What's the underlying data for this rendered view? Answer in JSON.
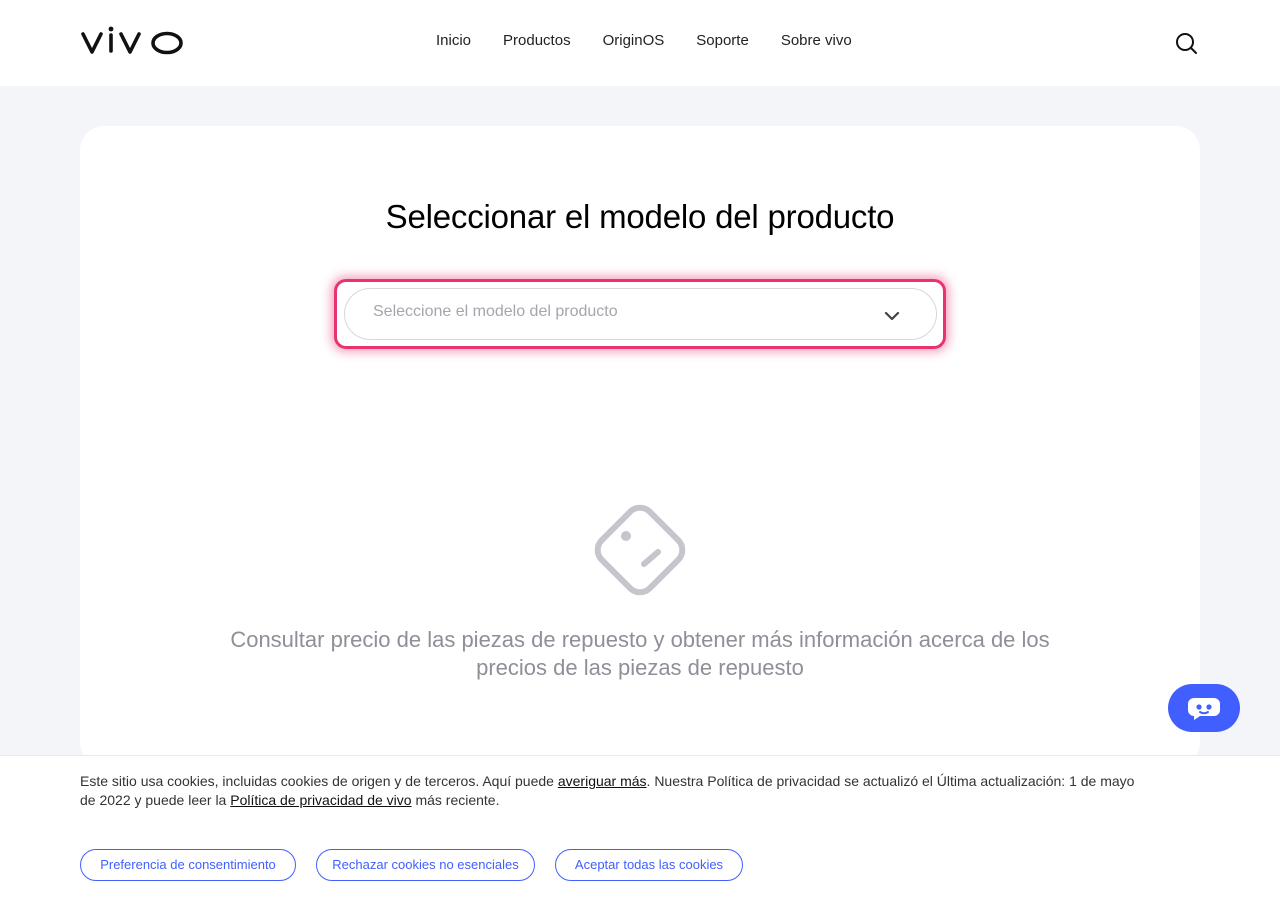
{
  "header": {
    "logo": "vivo",
    "nav": [
      "Inicio",
      "Productos",
      "OriginOS",
      "Soporte",
      "Sobre vivo"
    ],
    "search_icon": "search-icon"
  },
  "main": {
    "title": "Seleccionar el modelo del producto",
    "select": {
      "placeholder": "Seleccione el modelo del producto",
      "icon": "chevron-down-icon"
    },
    "empty_state": {
      "icon": "tag-face-icon",
      "text": "Consultar precio de las piezas de repuesto y obtener más información acerca de los precios de las piezas de repuesto"
    }
  },
  "chat_button": {
    "icon": "chatbot-icon"
  },
  "cookie_banner": {
    "text_part1": "Este sitio usa cookies, incluidas cookies de origen y de terceros. Aquí puede ",
    "link_learn_more": "averiguar más",
    "text_part2": ". Nuestra Política de privacidad se actualizó el Última actualización: 1 de mayo de 2022 y puede leer la ",
    "link_privacy": "Política de privacidad de vivo",
    "text_part3": " más reciente.",
    "buttons": {
      "preference": "Preferencia de consentimiento",
      "reject": "Rechazar cookies no esenciales",
      "accept": "Aceptar todas las cookies"
    }
  },
  "colors": {
    "accent": "#415fff",
    "highlight": "#e8336d",
    "page_bg": "#f4f5f9"
  }
}
